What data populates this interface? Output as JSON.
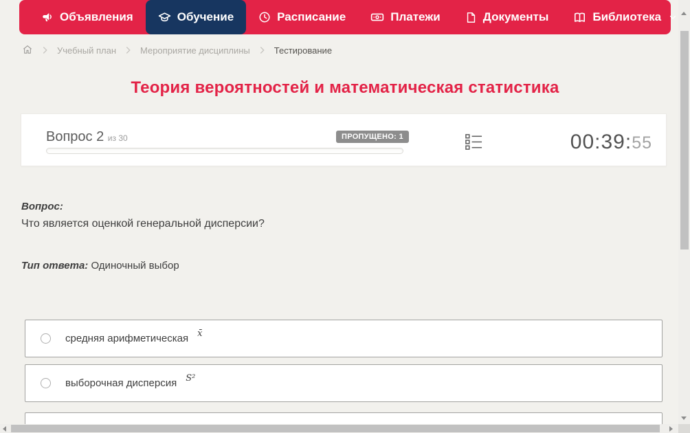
{
  "nav": {
    "items": [
      {
        "label": "Объявления",
        "icon": "megaphone-icon",
        "active": false
      },
      {
        "label": "Обучение",
        "icon": "graduation-cap-icon",
        "active": true
      },
      {
        "label": "Расписание",
        "icon": "clock-icon",
        "active": false
      },
      {
        "label": "Платежи",
        "icon": "banknote-icon",
        "active": false
      },
      {
        "label": "Документы",
        "icon": "document-icon",
        "active": false
      },
      {
        "label": "Библиотека",
        "icon": "book-icon",
        "active": false,
        "has_dropdown": true
      }
    ]
  },
  "breadcrumb": {
    "items": [
      "Учебный план",
      "Мероприятие дисциплины",
      "Тестирование"
    ]
  },
  "page_title": "Теория вероятностей и математическая статистика",
  "question_card": {
    "number_label": "Вопрос 2",
    "of_label": "из 30",
    "skipped_badge": "ПРОПУЩЕНО: 1",
    "timer_main": "00:39:",
    "timer_seconds": "55",
    "progress_percent": 0
  },
  "question": {
    "label": "Вопрос:",
    "text": "Что является оценкой генеральной дисперсии?",
    "answer_type_label": "Тип ответа:",
    "answer_type_value": "Одиночный выбор"
  },
  "answers": [
    {
      "text": "средняя арифметическая",
      "formula": "x̄"
    },
    {
      "text": "выборочная дисперсия",
      "formula": "S²"
    },
    {
      "text": "",
      "formula": ""
    }
  ],
  "colors": {
    "accent_red": "#e32347",
    "active_navy": "#173660",
    "badge_gray": "#8d8d8d",
    "page_bg": "#f2f1ed"
  }
}
